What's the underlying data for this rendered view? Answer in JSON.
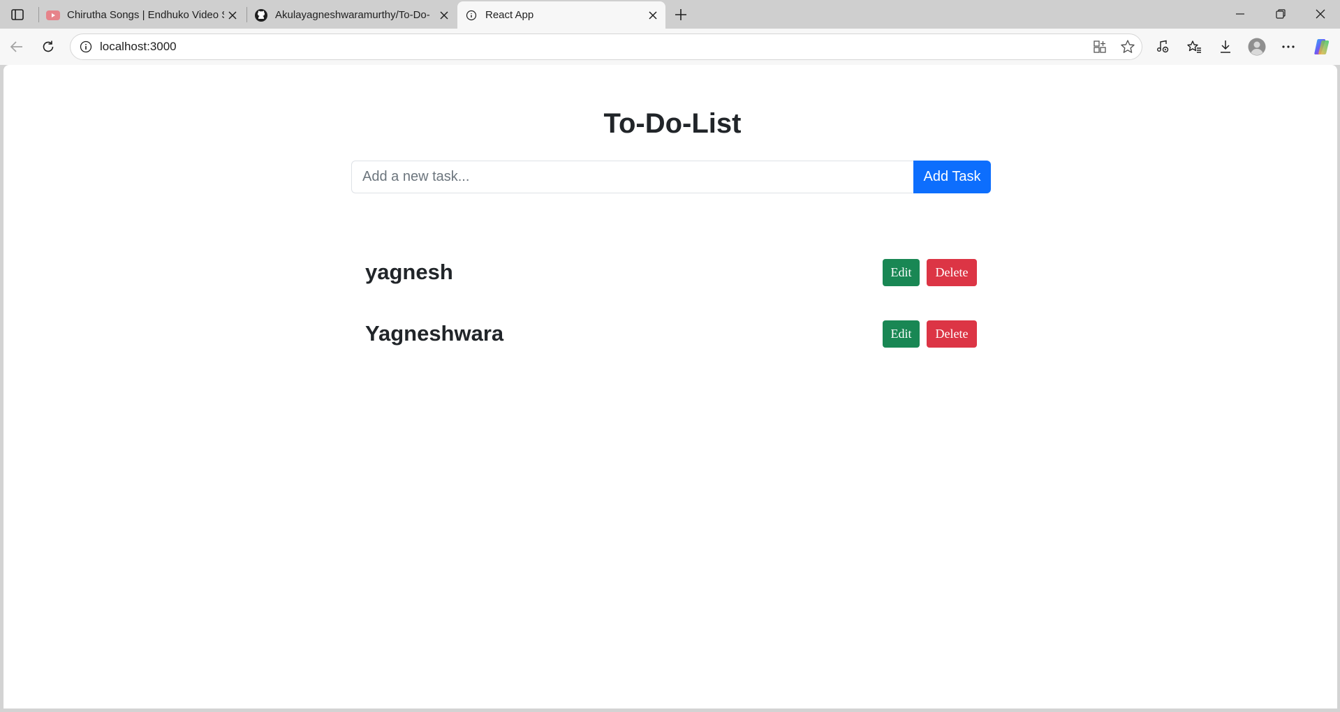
{
  "browser": {
    "tabs": [
      {
        "title": "Chirutha Songs | Endhuko Video S",
        "favicon": "youtube-icon",
        "active": false
      },
      {
        "title": "Akulayagneshwaramurthy/To-Do-",
        "favicon": "github-icon",
        "active": false
      },
      {
        "title": "React App",
        "favicon": "page-icon",
        "active": true
      }
    ],
    "url": "localhost:3000"
  },
  "app": {
    "title": "To-Do-List",
    "input": {
      "placeholder": "Add a new task...",
      "value": ""
    },
    "add_button_label": "Add Task",
    "tasks": [
      {
        "name": "yagnesh",
        "edit_label": "Edit",
        "delete_label": "Delete"
      },
      {
        "name": "Yagneshwara",
        "edit_label": "Edit",
        "delete_label": "Delete"
      }
    ]
  },
  "colors": {
    "primary": "#0d6efd",
    "success": "#198754",
    "danger": "#dc3545"
  }
}
